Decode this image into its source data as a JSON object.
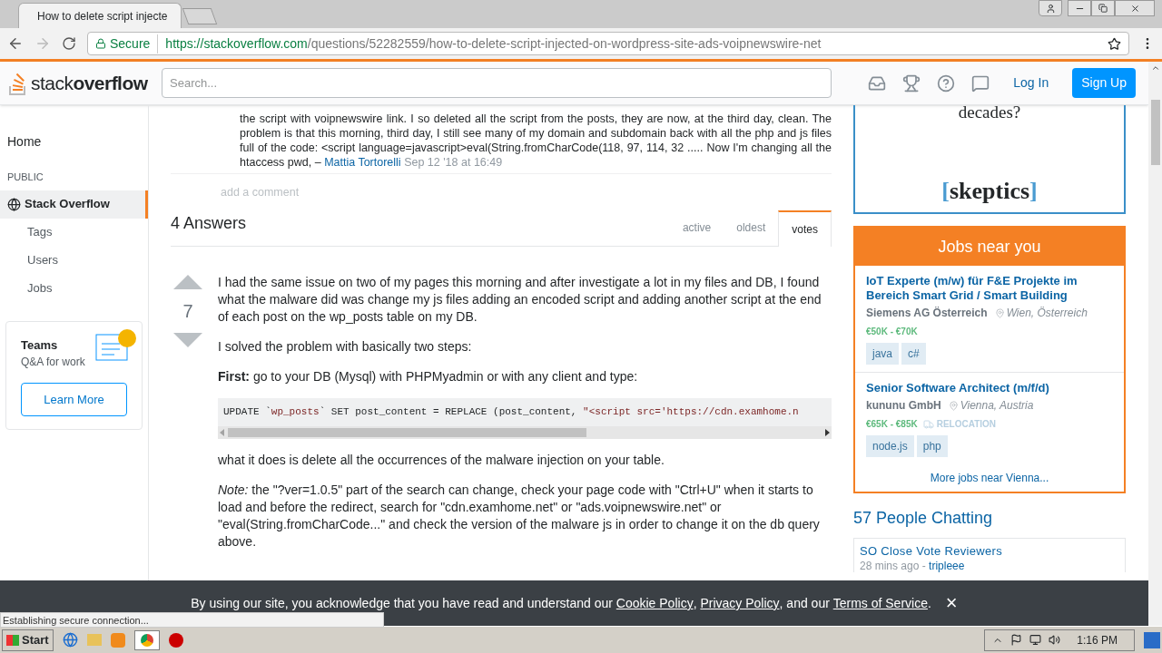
{
  "browser": {
    "tab_title": "How to delete script injecte",
    "secure_label": "Secure",
    "url_host": "https://stackoverflow.com",
    "url_path": "/questions/52282559/how-to-delete-script-injected-on-wordpress-site-ads-voipnewswire-net"
  },
  "header": {
    "logo_light": "stack",
    "logo_bold": "overflow",
    "search_placeholder": "Search...",
    "login": "Log In",
    "signup": "Sign Up"
  },
  "sidebar": {
    "home": "Home",
    "section": "PUBLIC",
    "items": [
      {
        "label": "Stack Overflow",
        "kind": "main",
        "selected": true
      },
      {
        "label": "Tags",
        "kind": "sub",
        "selected": false
      },
      {
        "label": "Users",
        "kind": "sub",
        "selected": false
      },
      {
        "label": "Jobs",
        "kind": "sub",
        "selected": false
      }
    ],
    "teams": {
      "title": "Teams",
      "subtitle": "Q&A for work",
      "button": "Learn More"
    }
  },
  "comment": {
    "text": "the script with voipnewswire link. I so deleted all the script from the posts, they are now, at the third day, clean. The problem is that this morning, third day, I still see many of my domain and subdomain back with all the php and js files full of the code: <script language=javascript>eval(String.fromCharCode(118, 97, 114, 32 ..... Now I'm changing all the htaccess pwd, –",
    "author": "Mattia Tortorelli",
    "date": "Sep 12 '18 at 16:49",
    "add": "add a comment"
  },
  "answers": {
    "heading": "4 Answers",
    "sort_tabs": [
      {
        "label": "active",
        "selected": false
      },
      {
        "label": "oldest",
        "selected": false
      },
      {
        "label": "votes",
        "selected": true
      }
    ]
  },
  "answer": {
    "votes": "7",
    "blocks": [
      {
        "kind": "text",
        "text": "I had the same issue on two of my pages this morning and after investigate a lot in my files and DB, I found what the malware did was change my js files adding an encoded script and adding another script at the end of each post on the wp_posts table on my DB."
      },
      {
        "kind": "text",
        "text": "I solved the problem with basically two steps:"
      },
      {
        "kind": "text",
        "text": "**First:** go to your DB (Mysql) with PHPMyadmin or with any client and type:"
      },
      {
        "kind": "code",
        "tokens": [
          {
            "kind": "plain",
            "text": "UPDATE `"
          },
          {
            "kind": "string",
            "text": "wp_posts"
          },
          {
            "kind": "plain",
            "text": "` SET post_content = REPLACE (post_content, "
          },
          {
            "kind": "string",
            "text": "\"<script src='https://cdn.examhome.n"
          }
        ]
      },
      {
        "kind": "text",
        "text": "what it does is delete all the occurrences of the malware injection on your table."
      },
      {
        "kind": "text",
        "text": "*Note:* the \"?ver=1.0.5\" part of the search can change, check your page code with \"Ctrl+U\" when it starts to load and before the redirect, search for \"cdn.examhome.net\" or \"ads.voipnewswire.net\" or \"eval(String.fromCharCode...\" and check the version of the malware js in order to change it on the db query above."
      }
    ]
  },
  "ad": {
    "text": "decades?",
    "logo_open": "[",
    "logo_word": "skeptics",
    "logo_close": "]"
  },
  "jobs": {
    "title": "Jobs near you",
    "items": [
      {
        "title": "IoT Experte (m/w) für F&E Projekte im Bereich Smart Grid / Smart Building",
        "company": "Siemens AG Österreich",
        "location": "Wien, Österreich",
        "salary": "€50K - €70K",
        "relocation": false,
        "tags": [
          "java",
          "c#"
        ]
      },
      {
        "title": "Senior Software Architect (m/f/d)",
        "company": "kununu GmbH",
        "location": "Vienna, Austria",
        "salary": "€65K - €85K",
        "relocation": true,
        "relocation_label": "RELOCATION",
        "tags": [
          "node.js",
          "php"
        ]
      }
    ],
    "more": "More jobs near Vienna..."
  },
  "chat": {
    "heading": "57 People Chatting",
    "rooms": [
      {
        "name": "SO Close Vote Reviewers",
        "time": "28 mins ago -",
        "user": "tripleee"
      }
    ]
  },
  "cookie": {
    "segments": [
      {
        "kind": "text",
        "text": "By using our site, you acknowledge that you have read and understand our "
      },
      {
        "kind": "link",
        "text": "Cookie Policy"
      },
      {
        "kind": "text",
        "text": ", "
      },
      {
        "kind": "link",
        "text": "Privacy Policy"
      },
      {
        "kind": "text",
        "text": ", and our "
      },
      {
        "kind": "link",
        "text": "Terms of Service"
      },
      {
        "kind": "text",
        "text": "."
      }
    ],
    "close": "×"
  },
  "status": "Establishing secure connection...",
  "taskbar": {
    "start": "Start",
    "clock": "1:16 PM"
  }
}
